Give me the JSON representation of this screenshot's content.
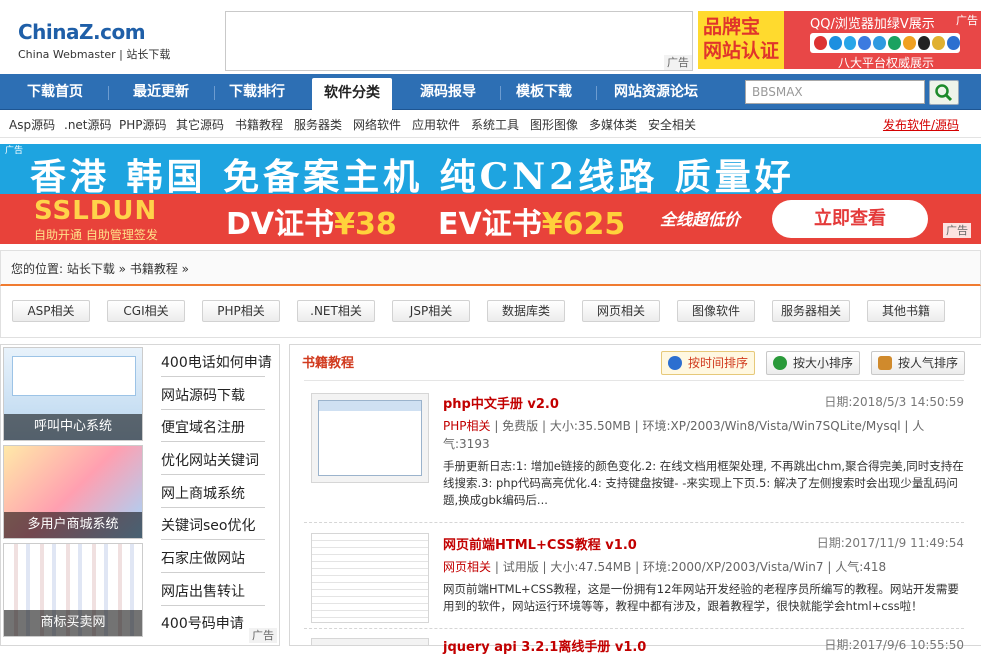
{
  "header": {
    "logo_main": "ChinaZ.com",
    "logo_sub": "China Webmaster | 站长下载",
    "top_ad_tag": "广告",
    "brand_left": "品牌宝\n网站认证",
    "brand_title": "QQ/浏览器加绿V展示",
    "brand_foot": "八大平台权威展示",
    "brand_ad_tag": "广告"
  },
  "nav": {
    "items": [
      {
        "label": "下载首页"
      },
      {
        "label": "最近更新"
      },
      {
        "label": "下载排行"
      },
      {
        "label": "软件分类"
      },
      {
        "label": "源码报导"
      },
      {
        "label": "模板下载"
      },
      {
        "label": "网站资源论坛"
      }
    ],
    "search_value": "BBSMAX"
  },
  "subnav": {
    "items": [
      "Asp源码",
      ".net源码",
      "PHP源码",
      "其它源码",
      "书籍教程",
      "服务器类",
      "网络软件",
      "应用软件",
      "系统工具",
      "图形图像",
      "多媒体类",
      "安全相关"
    ],
    "publish": "发布软件/源码"
  },
  "banner1": {
    "text": "香港 韩国 免备案主机 纯CN2线路 质量好",
    "ad_tag": "广告"
  },
  "banner2": {
    "logo": "SSLDUN",
    "sub": "自助开通  自助管理签发",
    "dv_label": "DV证书",
    "dv_price": "¥38",
    "ev_label": "EV证书",
    "ev_price": "¥625",
    "promo": "全线超低价",
    "button": "立即查看",
    "ad_tag": "广告"
  },
  "breadcrumb": "您的位置: 站长下载 » 书籍教程 »",
  "categories": [
    "ASP相关",
    "CGI相关",
    "PHP相关",
    ".NET相关",
    "JSP相关",
    "数据库类",
    "网页相关",
    "图像软件",
    "服务器相关",
    "其他书籍"
  ],
  "left": {
    "thumbs": [
      {
        "caption": "呼叫中心系统"
      },
      {
        "caption": "多用户商城系统"
      },
      {
        "caption": "商标买卖网"
      }
    ],
    "links": [
      "400电话如何申请",
      "网站源码下载",
      "便宜域名注册",
      "优化网站关键词",
      "网上商城系统",
      "关键词seo优化",
      "石家庄做网站",
      "网店出售转让",
      "400号码申请"
    ],
    "ad_tag": "广告"
  },
  "main": {
    "title": "书籍教程",
    "sort": [
      "按时间排序",
      "按大小排序",
      "按人气排序"
    ],
    "items": [
      {
        "title": "php中文手册 v2.0",
        "date": "日期:2018/5/3 14:50:59",
        "category": "PHP相关",
        "meta": " | 免费版 | 大小:35.50MB | 环境:XP/2003/Win8/Vista/Win7SQLite/Mysql | 人气:3193",
        "desc": "手册更新日志:1: 增加e链接的颜色变化.2: 在线文档用框架处理, 不再跳出chm,聚合得完美,同时支持在线搜索.3: php代码高亮优化.4: 支持键盘按键- -来实现上下页.5: 解决了左侧搜索时会出现少量乱码问题,换成gbk编码后..."
      },
      {
        "title": "网页前端HTML+CSS教程 v1.0",
        "date": "日期:2017/11/9 11:49:54",
        "category": "网页相关",
        "meta": " | 试用版 | 大小:47.54MB | 环境:2000/XP/2003/Vista/Win7 | 人气:418",
        "desc": "网页前端HTML+CSS教程，这是一份拥有12年网站开发经验的老程序员所编写的教程。网站开发需要用到的软件，网站运行环境等等，教程中都有涉及，跟着教程学，很快就能学会html+css啦！"
      },
      {
        "title": "jquery api 3.2.1离线手册 v1.0",
        "date": "日期:2017/9/6 10:55:50"
      }
    ]
  }
}
